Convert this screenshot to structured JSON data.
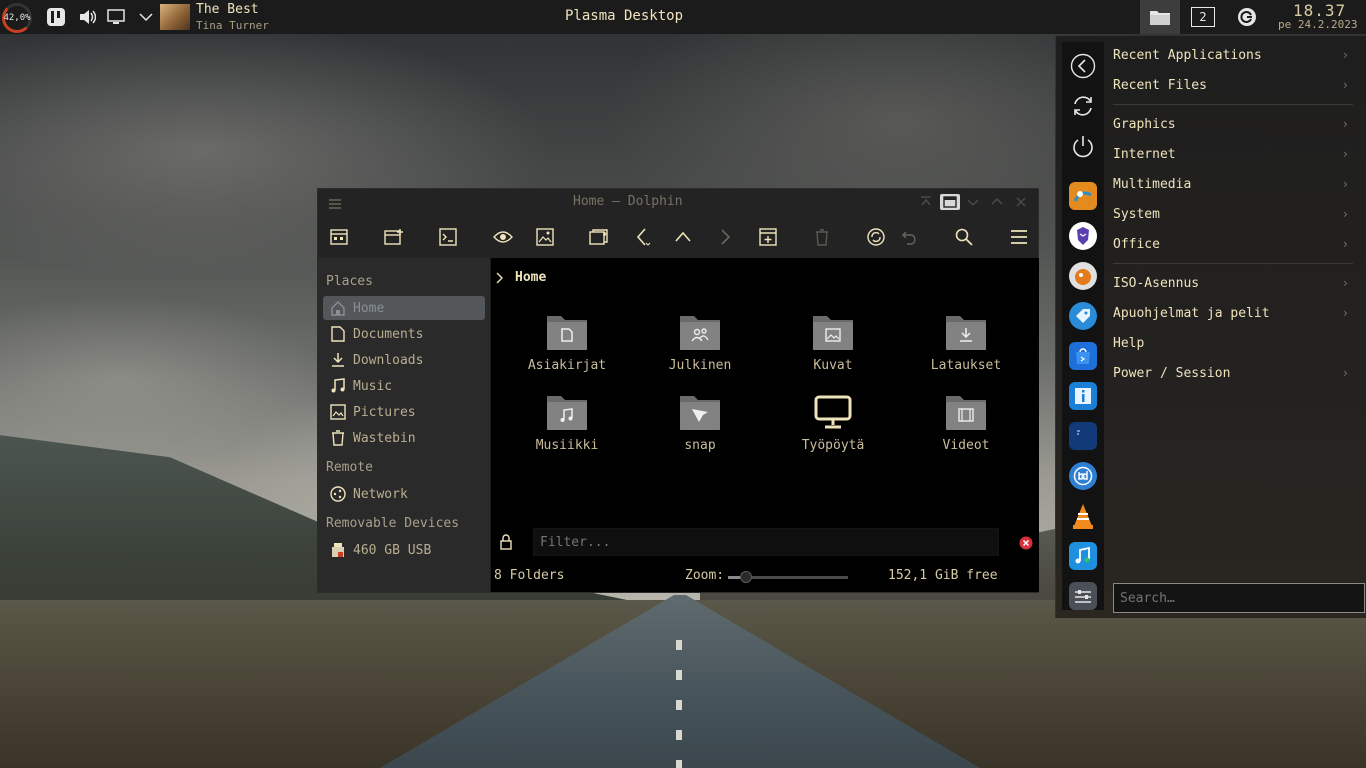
{
  "top_panel": {
    "cpu_load": "42,0%",
    "media": {
      "title": "The Best",
      "artist": "Tina Turner"
    },
    "active_window_title": "Plasma Desktop",
    "pager_number": "2",
    "clock_time": "18.37",
    "clock_date": "pe 24.2.2023"
  },
  "dolphin": {
    "title": "Home — Dolphin",
    "places": {
      "sections": [
        "Places",
        "Remote",
        "Removable Devices"
      ],
      "items": [
        {
          "label": "Home",
          "icon": "home-icon"
        },
        {
          "label": "Documents",
          "icon": "document-icon"
        },
        {
          "label": "Downloads",
          "icon": "download-icon"
        },
        {
          "label": "Music",
          "icon": "music-icon"
        },
        {
          "label": "Pictures",
          "icon": "picture-icon"
        },
        {
          "label": "Wastebin",
          "icon": "trash-icon"
        },
        {
          "label": "Network",
          "icon": "network-icon"
        },
        {
          "label": "460 GB USB",
          "icon": "usb-drive-icon"
        }
      ]
    },
    "breadcrumb": "Home",
    "folders": [
      {
        "label": "Asiakirjat",
        "icon": "document-folder-icon"
      },
      {
        "label": "Julkinen",
        "icon": "public-folder-icon"
      },
      {
        "label": "Kuvat",
        "icon": "pictures-folder-icon"
      },
      {
        "label": "Lataukset",
        "icon": "downloads-folder-icon"
      },
      {
        "label": "Musiikki",
        "icon": "music-folder-icon"
      },
      {
        "label": "snap",
        "icon": "snap-folder-icon"
      },
      {
        "label": "Työpöytä",
        "icon": "desktop-icon"
      },
      {
        "label": "Videot",
        "icon": "videos-folder-icon"
      }
    ],
    "filter_placeholder": "Filter...",
    "status": {
      "count": "8 Folders",
      "zoom_label": "Zoom:",
      "free_space": "152,1 GiB free",
      "zoom_level": 0.15
    }
  },
  "launcher": {
    "categories": [
      "Recent Applications",
      "Recent Files",
      "Graphics",
      "Internet",
      "Multimedia",
      "System",
      "Office",
      "ISO-Asennus",
      "Apuohjelmat ja pelit",
      "Help",
      "Power / Session"
    ],
    "search_placeholder": "Search…"
  },
  "colors": {
    "accent_text": "#efe3bc",
    "panel_bg": "#1b1b1b",
    "window_bg": "#1e1e1e",
    "places_active": "#54575a",
    "cpu_gauge": "#c93f1f"
  }
}
